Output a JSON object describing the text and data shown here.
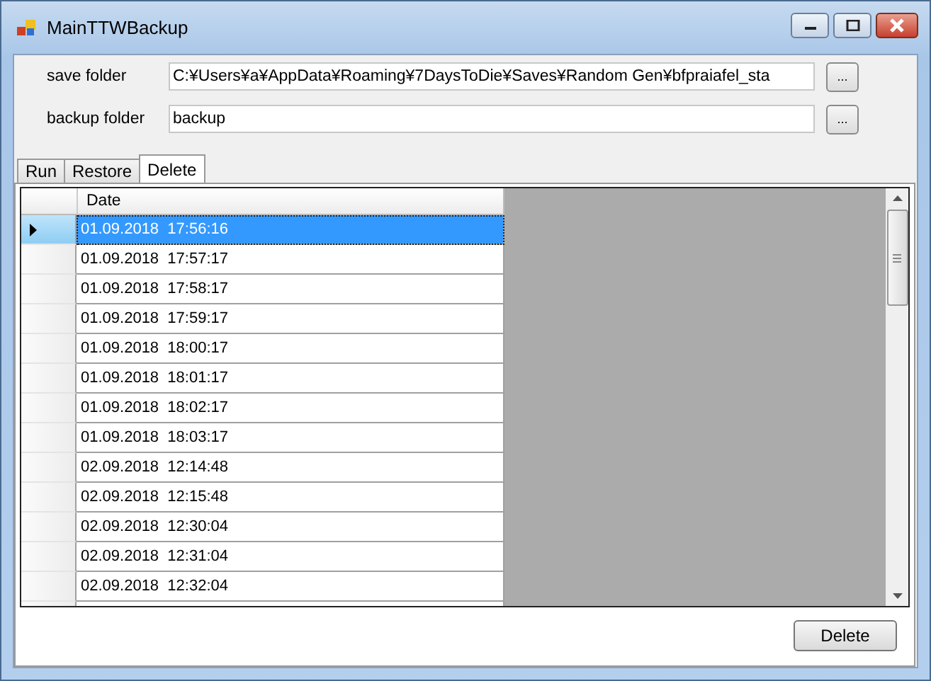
{
  "window": {
    "title": "MainTTWBackup"
  },
  "fields": [
    {
      "label": "save folder",
      "value": "C:¥Users¥a¥AppData¥Roaming¥7DaysToDie¥Saves¥Random Gen¥bfpraiafel_sta",
      "button": "..."
    },
    {
      "label": "backup folder",
      "value": "backup",
      "button": "..."
    }
  ],
  "tabs": [
    {
      "label": "Run",
      "selected": false
    },
    {
      "label": "Restore",
      "selected": false
    },
    {
      "label": "Delete",
      "selected": true
    }
  ],
  "table": {
    "columns": [
      "Date"
    ],
    "rows": [
      {
        "date": "01.09.2018  17:56:16",
        "selected": true
      },
      {
        "date": "01.09.2018  17:57:17",
        "selected": false
      },
      {
        "date": "01.09.2018  17:58:17",
        "selected": false
      },
      {
        "date": "01.09.2018  17:59:17",
        "selected": false
      },
      {
        "date": "01.09.2018  18:00:17",
        "selected": false
      },
      {
        "date": "01.09.2018  18:01:17",
        "selected": false
      },
      {
        "date": "01.09.2018  18:02:17",
        "selected": false
      },
      {
        "date": "01.09.2018  18:03:17",
        "selected": false
      },
      {
        "date": "02.09.2018  12:14:48",
        "selected": false
      },
      {
        "date": "02.09.2018  12:15:48",
        "selected": false
      },
      {
        "date": "02.09.2018  12:30:04",
        "selected": false
      },
      {
        "date": "02.09.2018  12:31:04",
        "selected": false
      },
      {
        "date": "02.09.2018  12:32:04",
        "selected": false
      }
    ]
  },
  "delete_button": "Delete"
}
